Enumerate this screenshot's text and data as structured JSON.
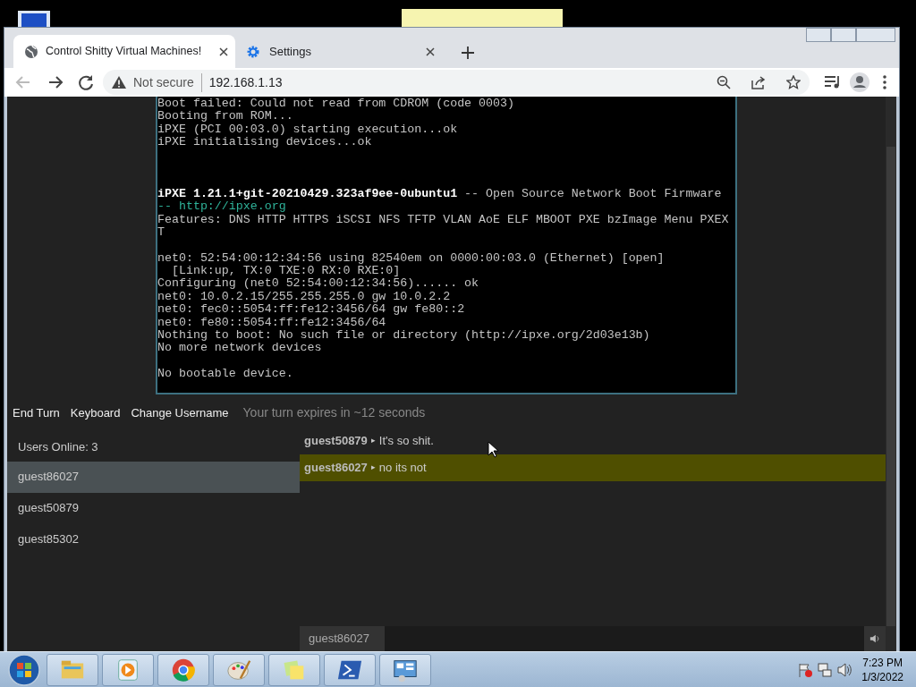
{
  "browser": {
    "tabs": [
      {
        "title": "Control Shitty Virtual Machines!",
        "kind": "site",
        "selected": true
      },
      {
        "title": "Settings",
        "kind": "settings",
        "selected": false
      }
    ],
    "address_bar": {
      "security": "Not secure",
      "url": "192.168.1.13"
    }
  },
  "terminal": {
    "lines": [
      {
        "kind": "normal",
        "text": "Boot failed: Could not read from CDROM (code 0003)"
      },
      {
        "kind": "normal",
        "text": "Booting from ROM..."
      },
      {
        "kind": "normal",
        "text": "iPXE (PCI 00:03.0) starting execution...ok"
      },
      {
        "kind": "normal",
        "text": "iPXE initialising devices...ok"
      },
      {
        "kind": "blank"
      },
      {
        "kind": "blank"
      },
      {
        "kind": "blank"
      },
      {
        "kind": "normal",
        "text": "**iPXE 1.21.1+git-20210429.323af9ee-0ubuntu1** -- Open Source Network Boot Firmware"
      },
      {
        "kind": "link",
        "text": "-- http://ipxe.org"
      },
      {
        "kind": "normal",
        "text": "Features: DNS HTTP HTTPS iSCSI NFS TFTP VLAN AoE ELF MBOOT PXE bzImage Menu PXEX"
      },
      {
        "kind": "normal",
        "text": "T"
      },
      {
        "kind": "blank"
      },
      {
        "kind": "normal",
        "text": "net0: 52:54:00:12:34:56 using 82540em on 0000:00:03.0 (Ethernet) [open]"
      },
      {
        "kind": "normal",
        "text": "  [Link:up, TX:0 TXE:0 RX:0 RXE:0]"
      },
      {
        "kind": "normal",
        "text": "Configuring (net0 52:54:00:12:34:56)...... ok"
      },
      {
        "kind": "normal",
        "text": "net0: 10.0.2.15/255.255.255.0 gw 10.0.2.2"
      },
      {
        "kind": "normal",
        "text": "net0: fec0::5054:ff:fe12:3456/64 gw fe80::2"
      },
      {
        "kind": "normal",
        "text": "net0: fe80::5054:ff:fe12:3456/64"
      },
      {
        "kind": "normal",
        "text": "Nothing to boot: No such file or directory (http://ipxe.org/2d03e13b)"
      },
      {
        "kind": "normal",
        "text": "No more network devices"
      },
      {
        "kind": "blank"
      },
      {
        "kind": "normal",
        "text": "No bootable device."
      }
    ]
  },
  "controls": {
    "buttons": [
      "End Turn",
      "Keyboard",
      "Change Username"
    ],
    "turn_status": "Your turn expires in ~12 seconds"
  },
  "users": {
    "header": "Users Online: 3",
    "items": [
      {
        "name": "guest86027",
        "selected": true
      },
      {
        "name": "guest50879",
        "selected": false
      },
      {
        "name": "guest85302",
        "selected": false
      }
    ]
  },
  "chat": {
    "messages": [
      {
        "user": "guest50879",
        "arrow": "▸",
        "text": "It's so shit.",
        "highlighted": false
      },
      {
        "user": "guest86027",
        "arrow": "▸",
        "text": "no its not",
        "highlighted": true
      }
    ]
  },
  "username_field": {
    "value": "guest86027"
  },
  "taskbar": {
    "time": "7:23 PM",
    "date": "1/3/2022"
  }
}
